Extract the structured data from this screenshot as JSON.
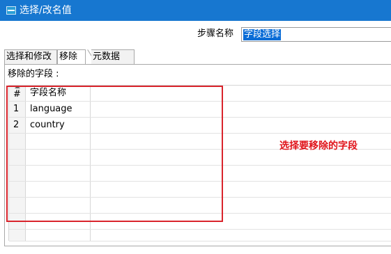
{
  "window": {
    "title": "选择/改名值",
    "icon": "app-window-icon"
  },
  "step": {
    "label": "步骤名称",
    "value": "字段选择"
  },
  "tabs": [
    {
      "label": "选择和修改",
      "active": false
    },
    {
      "label": "移除",
      "active": true
    },
    {
      "label": "元数据",
      "active": false
    }
  ],
  "remove_tab": {
    "fields_label": "移除的字段 :",
    "table": {
      "headers": {
        "num": "#",
        "name": "字段名称"
      },
      "rows": [
        {
          "num": "1",
          "name": "language"
        },
        {
          "num": "2",
          "name": "country"
        }
      ]
    }
  },
  "annotation": {
    "text": "选择要移除的字段",
    "color": "#e0141b"
  },
  "colors": {
    "titlebar": "#1777d0",
    "selection": "#0a6cd6",
    "highlight_box": "#d9232b"
  }
}
